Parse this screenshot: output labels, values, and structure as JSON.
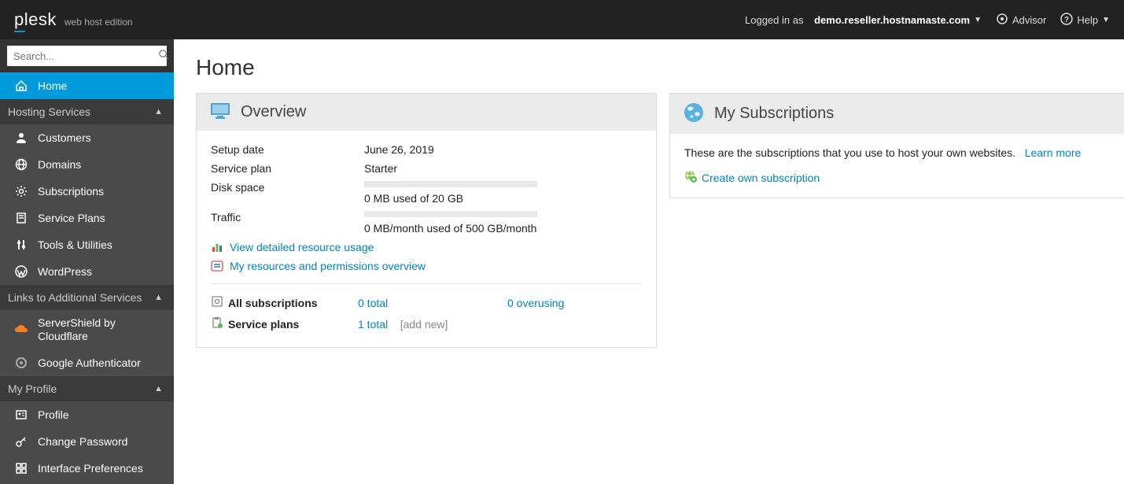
{
  "topbar": {
    "brand": "plesk",
    "edition": "web host edition",
    "logged_in_as_label": "Logged in as",
    "username": "demo.reseller.hostnamaste.com",
    "advisor": "Advisor",
    "help": "Help"
  },
  "search": {
    "placeholder": "Search..."
  },
  "nav": {
    "home": "Home",
    "section_hosting": "Hosting Services",
    "customers": "Customers",
    "domains": "Domains",
    "subscriptions": "Subscriptions",
    "service_plans": "Service Plans",
    "tools": "Tools & Utilities",
    "wordpress": "WordPress",
    "section_links": "Links to Additional Services",
    "servershield": "ServerShield by Cloudflare",
    "google_auth": "Google Authenticator",
    "section_profile": "My Profile",
    "profile": "Profile",
    "change_password": "Change Password",
    "interface_prefs": "Interface Preferences"
  },
  "page": {
    "title": "Home"
  },
  "overview": {
    "header": "Overview",
    "setup_date_label": "Setup date",
    "setup_date": "June 26, 2019",
    "service_plan_label": "Service plan",
    "service_plan": "Starter",
    "disk_label": "Disk space",
    "disk_usage": "0 MB used of 20 GB",
    "traffic_label": "Traffic",
    "traffic_usage": "0 MB/month used of 500 GB/month",
    "link_detailed": "View detailed resource usage",
    "link_resources": "My resources and permissions overview",
    "all_subs_label": "All subscriptions",
    "all_subs_total": "0 total",
    "all_subs_overusing": "0 overusing",
    "service_plans_label": "Service plans",
    "service_plans_total": "1 total",
    "service_plans_addnew": "[add new]"
  },
  "my_subs": {
    "header": "My Subscriptions",
    "desc": "These are the subscriptions that you use to host your own websites.",
    "learn_more": "Learn more",
    "create": "Create own subscription"
  }
}
